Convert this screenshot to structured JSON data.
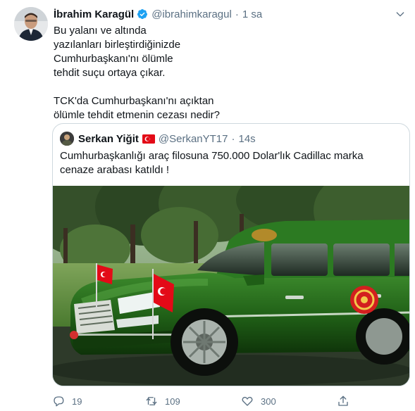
{
  "tweet": {
    "author_name": "İbrahim Karagül",
    "handle": "@ibrahimkaragul",
    "separator": "·",
    "time": "1 sa",
    "text_lines": [
      "Bu yalanı ve altında",
      "yazılanları birleştirdiğinizde",
      "Cumhurbaşkanı'nı ölümle",
      "tehdit suçu ortaya çıkar.",
      "",
      "TCK'da Cumhurbaşkanı'nı açıktan",
      "ölümle tehdit etmenin cezası nedir?"
    ],
    "icons": {
      "verified": "verified-badge-icon",
      "more": "chevron-down-icon"
    }
  },
  "quoted_tweet": {
    "author_name": "Serkan Yiğit",
    "flag": "turkish-flag-emoji",
    "handle": "@SerkanYT17",
    "separator": "·",
    "time": "14s",
    "text_lines": [
      "Cumhurbaşkanlığı araç filosuna 750.000 Dolar'lık Cadillac marka",
      "cenaze arabası katıldı !"
    ],
    "media": "green-cadillac-hearse-photo"
  },
  "actions": {
    "reply": {
      "icon": "reply-icon",
      "count": "19"
    },
    "retweet": {
      "icon": "retweet-icon",
      "count": "109"
    },
    "like": {
      "icon": "heart-icon",
      "count": "300"
    },
    "share": {
      "icon": "share-icon"
    }
  },
  "colors": {
    "text": "#0f1419",
    "secondary": "#5b7083",
    "verified": "#1da1f2",
    "border": "#cfd9de",
    "car_green": "#1f5e16"
  }
}
